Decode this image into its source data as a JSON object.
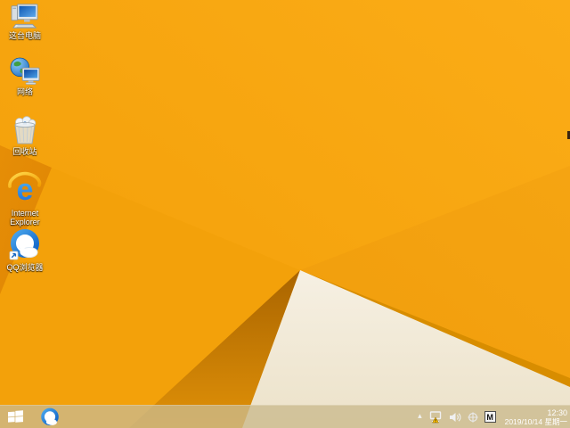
{
  "desktop": {
    "icons": [
      {
        "id": "this-pc",
        "label": "这台电脑"
      },
      {
        "id": "network",
        "label": "网络"
      },
      {
        "id": "recycle-bin",
        "label": "回收站"
      },
      {
        "id": "internet-explorer",
        "label": "Internet Explorer"
      },
      {
        "id": "qq-browser",
        "label": "QQ浏览器"
      }
    ],
    "wallpaper": {
      "style": "windows-8.1-default-folded-paper",
      "base_orange": "#F6A40D",
      "dark_fold_orange": "#E28905",
      "shadow_brown": "#AE6802",
      "cream": "#F3EDDE",
      "gold_edge": "#D88D00"
    }
  },
  "taskbar": {
    "pinned": [
      {
        "id": "qq-browser-taskbar",
        "label": "QQ浏览器"
      }
    ],
    "tray": {
      "hidden_icons_glyph": "▴",
      "icons": [
        {
          "id": "network-status",
          "state": "warning"
        },
        {
          "id": "volume"
        },
        {
          "id": "tray-globe"
        },
        {
          "id": "input-method"
        }
      ],
      "ime_label": "M",
      "clock_time": "12:30",
      "clock_date": "2019/10/14 星期一"
    }
  }
}
